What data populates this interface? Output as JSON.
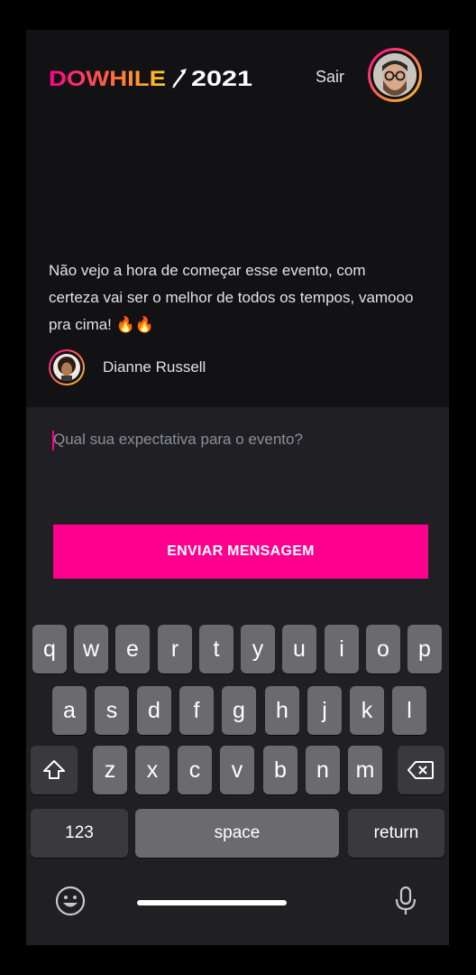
{
  "header": {
    "logo_text": "DOWHILE 2021",
    "logout_label": "Sair",
    "user_avatar": "user-avatar"
  },
  "message": {
    "text": "Não vejo a hora de começar esse evento, com certeza vai ser o melhor de todos os tempos, vamooo pra cima! 🔥🔥",
    "author_name": "Dianne Russell"
  },
  "composer": {
    "placeholder": "Qual sua expectativa para o evento?",
    "send_label": "ENVIAR MENSAGEM"
  },
  "keyboard": {
    "row1": [
      "q",
      "w",
      "e",
      "r",
      "t",
      "y",
      "u",
      "i",
      "o",
      "p"
    ],
    "row2": [
      "a",
      "s",
      "d",
      "f",
      "g",
      "h",
      "j",
      "k",
      "l"
    ],
    "row3": [
      "z",
      "x",
      "c",
      "v",
      "b",
      "n",
      "m"
    ],
    "numbers_label": "123",
    "space_label": "space",
    "return_label": "return",
    "icons": [
      "shift-icon",
      "backspace-icon",
      "emoji-icon",
      "microphone-icon"
    ]
  },
  "colors": {
    "background": "#121214",
    "composer_bg": "#202024",
    "accent": "#ff008e",
    "gradient_end": "#ffcd1e",
    "text": "#e1e1e6",
    "placeholder": "#8d8d99"
  }
}
